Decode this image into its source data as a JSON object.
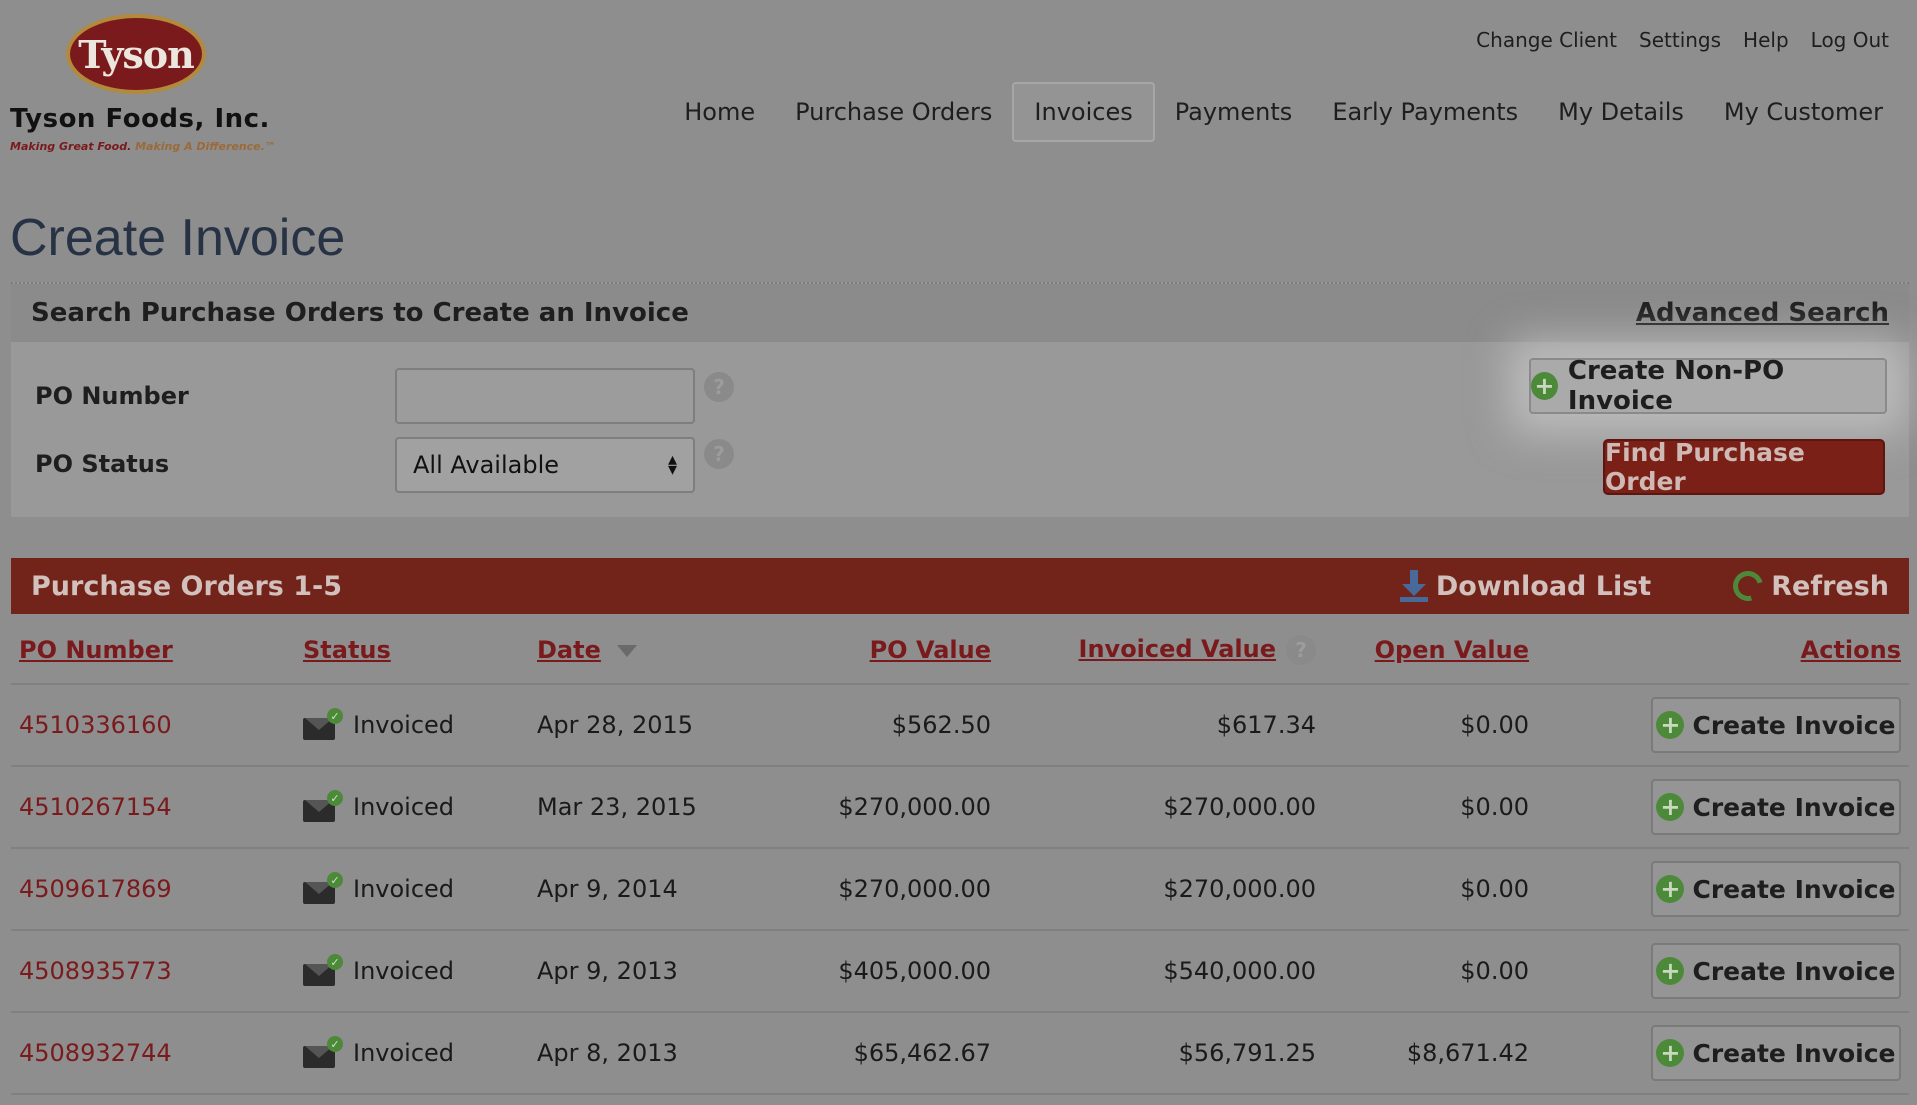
{
  "logo": {
    "mark": "Tyson",
    "company": "Tyson Foods, Inc.",
    "tagline_1": "Making Great Food.",
    "tagline_2": "Making A Difference.™"
  },
  "topbar": [
    "Change Client",
    "Settings",
    "Help",
    "Log Out"
  ],
  "nav": [
    "Home",
    "Purchase Orders",
    "Invoices",
    "Payments",
    "Early Payments",
    "My Details",
    "My Customer"
  ],
  "nav_active": "Invoices",
  "page_title": "Create Invoice",
  "search": {
    "heading": "Search Purchase Orders to Create an Invoice",
    "advanced_link": "Advanced Search",
    "po_number_label": "PO Number",
    "po_number_value": "",
    "po_status_label": "PO Status",
    "po_status_value": "All Available",
    "create_nonpo_label": "Create Non-PO Invoice",
    "find_label": "Find Purchase Order",
    "help_glyph": "?"
  },
  "results": {
    "title": "Purchase Orders 1-5",
    "download_label": "Download List",
    "refresh_label": "Refresh",
    "columns": [
      "PO Number",
      "Status",
      "Date",
      "PO Value",
      "Invoiced Value",
      "Open Value",
      "Actions"
    ],
    "rows": [
      {
        "po": "4510336160",
        "status": "Invoiced",
        "date": "Apr 28, 2015",
        "po_value": "$562.50",
        "invoiced": "$617.34",
        "open": "$0.00",
        "action": "Create Invoice"
      },
      {
        "po": "4510267154",
        "status": "Invoiced",
        "date": "Mar 23, 2015",
        "po_value": "$270,000.00",
        "invoiced": "$270,000.00",
        "open": "$0.00",
        "action": "Create Invoice"
      },
      {
        "po": "4509617869",
        "status": "Invoiced",
        "date": "Apr 9, 2014",
        "po_value": "$270,000.00",
        "invoiced": "$270,000.00",
        "open": "$0.00",
        "action": "Create Invoice"
      },
      {
        "po": "4508935773",
        "status": "Invoiced",
        "date": "Apr 9, 2013",
        "po_value": "$405,000.00",
        "invoiced": "$540,000.00",
        "open": "$0.00",
        "action": "Create Invoice"
      },
      {
        "po": "4508932744",
        "status": "Invoiced",
        "date": "Apr 8, 2013",
        "po_value": "$65,462.67",
        "invoiced": "$56,791.25",
        "open": "$8,671.42",
        "action": "Create Invoice"
      }
    ]
  },
  "icons": {
    "plus": "plus-circle-icon",
    "download": "download-icon",
    "refresh": "refresh-icon",
    "status": "envelope-check-icon",
    "help": "help-icon",
    "sort": "sort-desc-icon",
    "select": "select-arrows-icon"
  },
  "colors": {
    "brand_red": "#7a1a1c",
    "button_red": "#7a2017",
    "accent_green": "#4c8a3a",
    "title_blue": "#273344"
  }
}
